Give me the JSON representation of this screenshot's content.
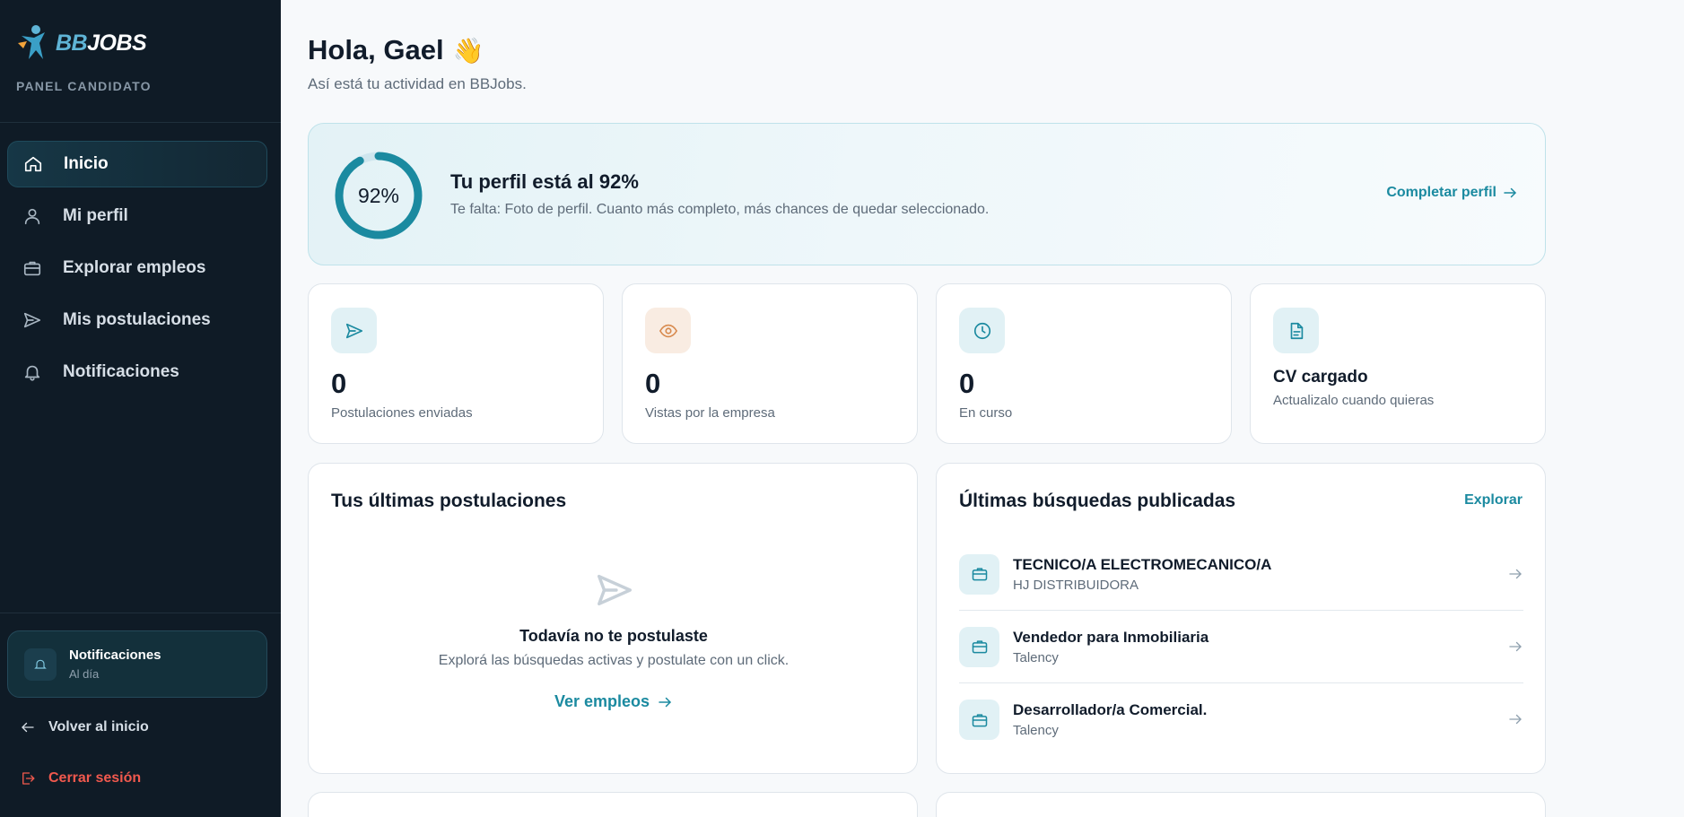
{
  "brand": {
    "bb": "BB",
    "jobs": "JOBS",
    "panel_label": "PANEL CANDIDATO"
  },
  "sidebar": {
    "items": [
      {
        "label": "Inicio",
        "icon": "home-icon",
        "active": true
      },
      {
        "label": "Mi perfil",
        "icon": "user-icon",
        "active": false
      },
      {
        "label": "Explorar empleos",
        "icon": "briefcase-icon",
        "active": false
      },
      {
        "label": "Mis postulaciones",
        "icon": "send-icon",
        "active": false
      },
      {
        "label": "Notificaciones",
        "icon": "bell-icon",
        "active": false
      }
    ],
    "notifications": {
      "title": "Notificaciones",
      "status": "Al día"
    },
    "back_label": "Volver al inicio",
    "logout_label": "Cerrar sesión"
  },
  "header": {
    "greeting": "Hola, Gael",
    "wave": "👋",
    "subtitle": "Así está tu actividad en BBJobs."
  },
  "profile": {
    "percent": 92,
    "percent_label": "92%",
    "title": "Tu perfil está al 92%",
    "description": "Te falta: Foto de perfil. Cuanto más completo, más chances de quedar seleccionado.",
    "cta": "Completar perfil"
  },
  "stats": [
    {
      "value": "0",
      "label": "Postulaciones enviadas",
      "icon": "send-icon"
    },
    {
      "value": "0",
      "label": "Vistas por la empresa",
      "icon": "eye-icon"
    },
    {
      "value": "0",
      "label": "En curso",
      "icon": "clock-icon"
    },
    {
      "title": "CV cargado",
      "label": "Actualizalo cuando quieras",
      "icon": "document-icon"
    }
  ],
  "recent_applications": {
    "title": "Tus últimas postulaciones",
    "empty_title": "Todavía no te postulaste",
    "empty_sub": "Explorá las búsquedas activas y postulate con un click.",
    "cta": "Ver empleos"
  },
  "latest_jobs": {
    "title": "Últimas búsquedas publicadas",
    "explore_label": "Explorar",
    "items": [
      {
        "title": "TECNICO/A ELECTROMECANICO/A",
        "company": "HJ DISTRIBUIDORA"
      },
      {
        "title": "Vendedor para Inmobiliaria",
        "company": "Talency"
      },
      {
        "title": "Desarrollador/a Comercial.",
        "company": "Talency"
      }
    ]
  },
  "colors": {
    "sidebar_bg": "#0f1b26",
    "accent": "#1b8aa0",
    "danger": "#f1594e",
    "ring_track": "#cfe6ee"
  }
}
